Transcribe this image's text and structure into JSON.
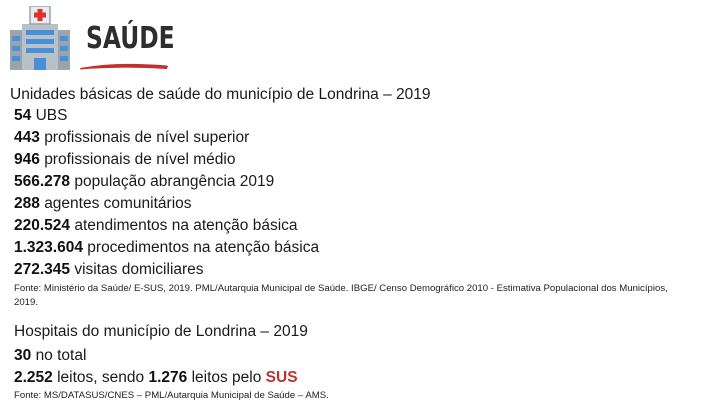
{
  "header": {
    "title": "SAÚDE",
    "icon": "hospital-icon"
  },
  "ubs_section": {
    "title": "Unidades básicas de saúde do município de Londrina – 2019",
    "stats": [
      {
        "value": "54",
        "label": "UBS"
      },
      {
        "value": "443",
        "label": "profissionais de nível superior"
      },
      {
        "value": "946",
        "label": "profissionais de nível médio"
      },
      {
        "value": "566.278",
        "label": "população abrangência 2019"
      },
      {
        "value": "288",
        "label": "agentes comunitários"
      },
      {
        "value": "220.524",
        "label": "atendimentos na atenção básica"
      },
      {
        "value": "1.323.604",
        "label": "procedimentos na atenção básica"
      },
      {
        "value": "272.345",
        "label": "visitas domiciliares"
      }
    ],
    "source": "Fonte: Ministério da Saúde/ E-SUS, 2019. PML/Autarquia Municipal de Saúde. IBGE/ Censo Demográfico 2010 - Estimativa Populacional dos Municípios, 2019."
  },
  "hospital_section": {
    "title": "Hospitais do município de Londrina – 2019",
    "total_value": "30",
    "total_label": "no total",
    "beds_value": "2.252",
    "beds_text": "leitos, sendo",
    "sus_beds_value": "1.276",
    "sus_beds_text": "leitos pelo",
    "sus_label": "SUS",
    "source": "Fonte: MS/DATASUS/CNES – PML/Autarquia Municipal de Saúde – AMS."
  },
  "colors": {
    "accent": "#c0302c",
    "icon_blue": "#4a90d9",
    "icon_gray": "#9aa4ad"
  }
}
